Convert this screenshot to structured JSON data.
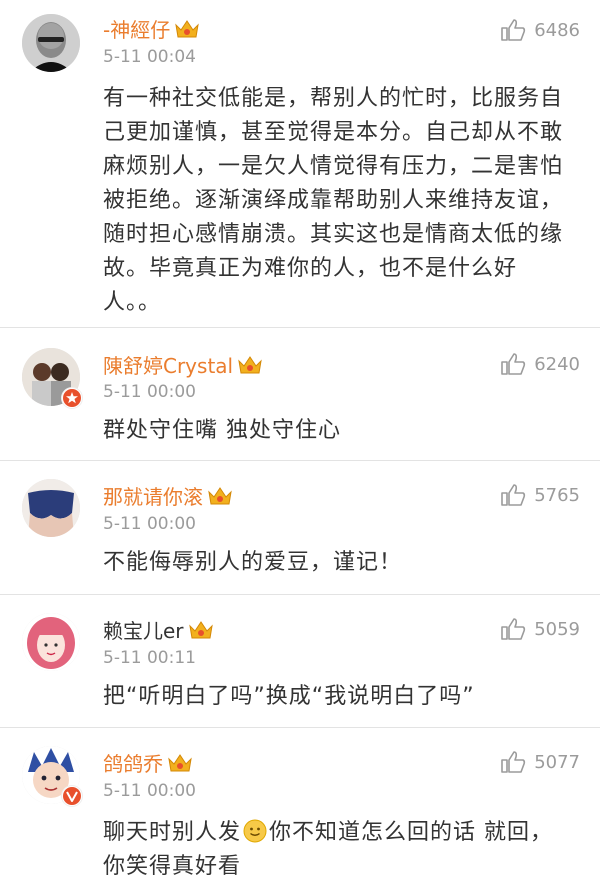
{
  "comments": [
    {
      "name": "-神經仔",
      "time": "5-11 00:04",
      "likes": "6486",
      "text": "有一种社交低能是，帮别人的忙时，比服务自己更加谨慎，甚至觉得是本分。自己却从不敢麻烦别人，一是欠人情觉得有压力，二是害怕被拒绝。逐渐演绎成靠帮助别人来维持友谊，随时担心感情崩溃。其实这也是情商太低的缘故。毕竟真正为难你的人，也不是什么好人。。",
      "avatar_icon": "bald-man-avatar"
    },
    {
      "name": "陳舒婷Crystal",
      "time": "5-11 00:00",
      "likes": "6240",
      "text": "群处守住嘴  独处守住心",
      "avatar_icon": "couple-photo-avatar"
    },
    {
      "name": "那就请你滚",
      "time": "5-11 00:00",
      "likes": "5765",
      "text": "不能侮辱别人的爱豆，谨记！",
      "avatar_icon": "denim-shorts-avatar"
    },
    {
      "name": "赖宝儿er",
      "time": "5-11 00:11",
      "likes": "5059",
      "text": "把“听明白了吗”换成“我说明白了吗”",
      "avatar_icon": "cartoon-girl-avatar"
    },
    {
      "name": "鸽鸽乔",
      "time": "5-11 00:00",
      "likes": "5077",
      "text_before_emoji": "聊天时别人发",
      "text_after_emoji": "你不知道怎么回的话  就回，你笑得真好看",
      "emoji_icon": "smile-emoji-icon",
      "avatar_icon": "anime-character-avatar"
    }
  ],
  "colors": {
    "name": "#ea7d2e",
    "meta": "#9b9b9b",
    "text": "#333333",
    "divider": "#e3e3e3"
  }
}
